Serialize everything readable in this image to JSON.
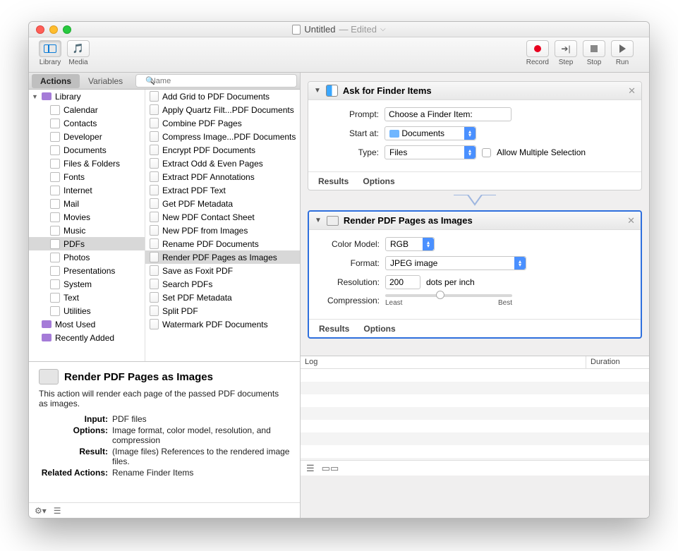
{
  "window": {
    "title": "Untitled",
    "edited": "— Edited"
  },
  "toolbar": {
    "library": "Library",
    "media": "Media",
    "record": "Record",
    "step": "Step",
    "stop": "Stop",
    "run": "Run"
  },
  "tabs": {
    "actions": "Actions",
    "variables": "Variables"
  },
  "search_placeholder": "Name",
  "library": {
    "root": "Library",
    "items": [
      "Calendar",
      "Contacts",
      "Developer",
      "Documents",
      "Files & Folders",
      "Fonts",
      "Internet",
      "Mail",
      "Movies",
      "Music",
      "PDFs",
      "Photos",
      "Presentations",
      "System",
      "Text",
      "Utilities"
    ],
    "selected": "PDFs",
    "extras": [
      "Most Used",
      "Recently Added"
    ]
  },
  "actions_list": {
    "items": [
      "Add Grid to PDF Documents",
      "Apply Quartz Filt...PDF Documents",
      "Combine PDF Pages",
      "Compress Image...PDF Documents",
      "Encrypt PDF Documents",
      "Extract Odd & Even Pages",
      "Extract PDF Annotations",
      "Extract PDF Text",
      "Get PDF Metadata",
      "New PDF Contact Sheet",
      "New PDF from Images",
      "Rename PDF Documents",
      "Render PDF Pages as Images",
      "Save as Foxit PDF",
      "Search PDFs",
      "Set PDF Metadata",
      "Split PDF",
      "Watermark PDF Documents"
    ],
    "selected": "Render PDF Pages as Images"
  },
  "info": {
    "title": "Render PDF Pages as Images",
    "desc": "This action will render each page of the passed PDF documents as images.",
    "rows": {
      "Input": "PDF files",
      "Options": "Image format, color model, resolution, and compression",
      "Result": "(Image files) References to the rendered image files.",
      "Related Actions": "Rename Finder Items"
    }
  },
  "wf": {
    "ask": {
      "title": "Ask for Finder Items",
      "prompt_label": "Prompt:",
      "prompt_value": "Choose a Finder Item:",
      "start_label": "Start at:",
      "start_value": "Documents",
      "type_label": "Type:",
      "type_value": "Files",
      "allow_label": "Allow Multiple Selection",
      "results": "Results",
      "options": "Options"
    },
    "render": {
      "title": "Render PDF Pages as Images",
      "color_label": "Color Model:",
      "color_value": "RGB",
      "format_label": "Format:",
      "format_value": "JPEG image",
      "res_label": "Resolution:",
      "res_value": "200",
      "res_suffix": "dots per inch",
      "comp_label": "Compression:",
      "comp_least": "Least",
      "comp_best": "Best",
      "results": "Results",
      "options": "Options"
    }
  },
  "log": {
    "col1": "Log",
    "col2": "Duration"
  }
}
